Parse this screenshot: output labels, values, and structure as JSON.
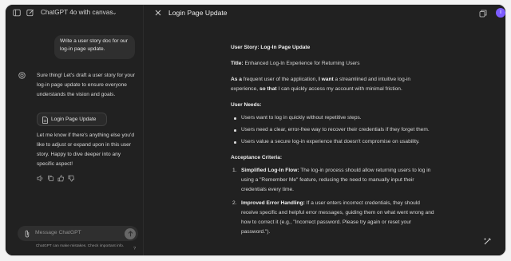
{
  "header": {
    "model_title": "ChatGPT 4o with canvas",
    "doc_title": "Login Page Update",
    "avatar_initial": "I"
  },
  "chat": {
    "user_message": "Write a user story doc for our log-in page update.",
    "assistant_intro": "Sure thing! Let's draft a user story for your log-in page update to ensure everyone understands the vision and goals.",
    "doc_chip_label": "Login Page Update",
    "assistant_followup": "Let me know if there's anything else you'd like to adjust or expand upon in this user story. Happy to dive deeper into any specific aspect!"
  },
  "composer": {
    "placeholder": "Message ChatGPT",
    "disclaimer": "ChatGPT can make mistakes. Check important info.",
    "help_label": "?"
  },
  "document": {
    "heading": "User Story: Log-In Page Update",
    "title_label": "Title:",
    "title_value": "Enhanced Log-In Experience for Returning Users",
    "story": {
      "as_a": "As a",
      "p1": "frequent user of the application,",
      "i_want": "I want",
      "p2": "a streamlined and intuitive log-in experience,",
      "so_that": "so that",
      "p3": "I can quickly access my account with minimal friction."
    },
    "needs_heading": "User Needs:",
    "needs": [
      "Users want to log in quickly without repetitive steps.",
      "Users need a clear, error-free way to recover their credentials if they forget them.",
      "Users value a secure log-in experience that doesn't compromise on usability."
    ],
    "criteria_heading": "Acceptance Criteria:",
    "criteria": [
      {
        "num": "1.",
        "title": "Simplified Log-In Flow:",
        "text": "The log-in process should allow returning users to log in using a \"Remember Me\" feature, reducing the need to manually input their credentials every time."
      },
      {
        "num": "2.",
        "title": "Improved Error Handling:",
        "text": "If a user enters incorrect credentials, they should receive specific and helpful error messages, guiding them on what went wrong and how to correct it (e.g., \"Incorrect password. Please try again or reset your password.\")."
      }
    ]
  },
  "colors": {
    "background": "#212121",
    "bubble": "#2f2f2f",
    "avatar": "#7c5cff",
    "text": "#d8d8d8"
  }
}
